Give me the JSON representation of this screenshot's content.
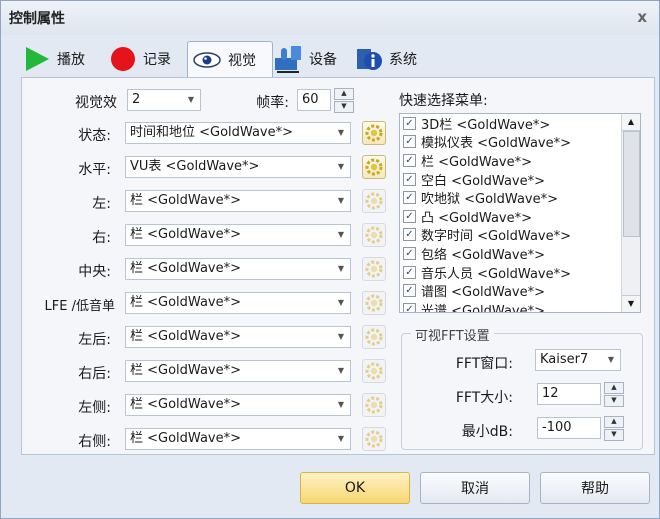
{
  "window": {
    "title": "控制属性",
    "close_glyph": "x"
  },
  "tabs": [
    {
      "label": "播放",
      "icon": "play-icon"
    },
    {
      "label": "记录",
      "icon": "record-icon"
    },
    {
      "label": "视觉",
      "icon": "eye-icon",
      "active": true
    },
    {
      "label": "设备",
      "icon": "device-icon"
    },
    {
      "label": "系统",
      "icon": "system-info-icon"
    }
  ],
  "visual": {
    "label": "视觉效",
    "value": "2"
  },
  "framerate": {
    "label": "帧率:",
    "value": "60"
  },
  "rows": [
    {
      "label": "状态:",
      "value": "时间和地位 <GoldWave*>",
      "gear_active": true
    },
    {
      "label": "水平:",
      "value": "VU表 <GoldWave*>",
      "gear_active": true
    },
    {
      "label": "左:",
      "value": "栏 <GoldWave*>",
      "gear_active": false
    },
    {
      "label": "右:",
      "value": "栏 <GoldWave*>",
      "gear_active": false
    },
    {
      "label": "中央:",
      "value": "栏 <GoldWave*>",
      "gear_active": false
    },
    {
      "label": "LFE /低音单",
      "value": "栏 <GoldWave*>",
      "gear_active": false
    },
    {
      "label": "左后:",
      "value": "栏 <GoldWave*>",
      "gear_active": false
    },
    {
      "label": "右后:",
      "value": "栏 <GoldWave*>",
      "gear_active": false
    },
    {
      "label": "左侧:",
      "value": "栏 <GoldWave*>",
      "gear_active": false
    },
    {
      "label": "右侧:",
      "value": "栏 <GoldWave*>",
      "gear_active": false
    }
  ],
  "quick_menu": {
    "label": "快速选择菜单:",
    "items": [
      "3D栏 <GoldWave*>",
      "模拟仪表 <GoldWave*>",
      "栏 <GoldWave*>",
      "空白 <GoldWave*>",
      "吹地狱 <GoldWave*>",
      "凸 <GoldWave*>",
      "数字时间 <GoldWave*>",
      "包络 <GoldWave*>",
      "音乐人员 <GoldWave*>",
      "谱图 <GoldWave*>",
      "光谱 <GoldWave*>"
    ]
  },
  "fft": {
    "group_title": "可视FFT设置",
    "window_label": "FFT窗口:",
    "window_value": "Kaiser7",
    "size_label": "FFT大小:",
    "size_value": "12",
    "mindb_label": "最小dB:",
    "mindb_value": "-100"
  },
  "buttons": {
    "ok": "OK",
    "cancel": "取消",
    "help": "帮助"
  },
  "colors": {
    "ok_button": "#f8d771",
    "play": "#22b83a",
    "record": "#e5141b"
  }
}
